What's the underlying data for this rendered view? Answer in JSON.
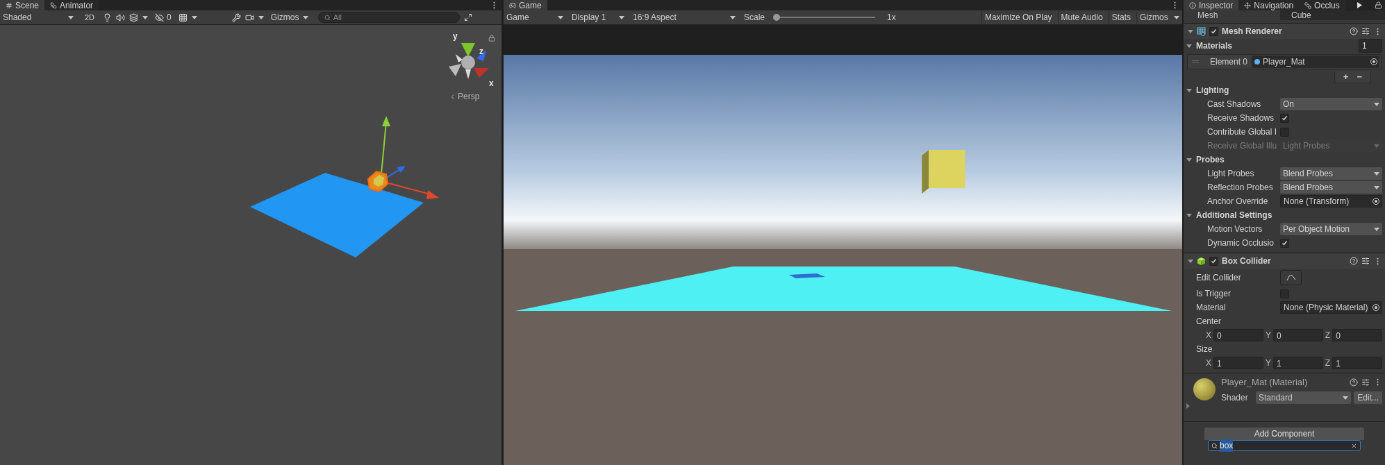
{
  "scene_panel": {
    "tabs": [
      {
        "label": "Scene",
        "selected": true
      },
      {
        "label": "Animator",
        "selected": false
      }
    ],
    "toolbar": {
      "shading": "Shaded",
      "mode_2d": "2D",
      "hidden_count": "0",
      "gizmos": "Gizmos",
      "search": {
        "placeholder": "All"
      }
    },
    "axis_labels": [
      "y",
      "z",
      "x"
    ],
    "view_label": "Persp"
  },
  "game_panel": {
    "tabs": [
      {
        "label": "Game",
        "selected": true
      }
    ],
    "toolbar": {
      "mode": "Game",
      "display": "Display 1",
      "aspect": "16:9 Aspect",
      "scale_label": "Scale",
      "scale": {
        "level": 0,
        "reading": "1x"
      },
      "buttons": [
        "Maximize On Play",
        "Mute Audio",
        "Stats"
      ],
      "gizmos": "Gizmos"
    }
  },
  "inspector": {
    "tabs": [
      {
        "label": "Inspector",
        "selected": true
      },
      {
        "label": "Navigation",
        "selected": false
      },
      {
        "label": "Occlus",
        "selected": false
      }
    ],
    "cut_row": {
      "label": "Mesh",
      "value": "Cube"
    },
    "components": [
      {
        "title": "Mesh Renderer",
        "enabled": true,
        "expanded": true,
        "rows": [
          {
            "kind": "section",
            "label": "Materials",
            "count": "1",
            "expanded": true,
            "children": [
              {
                "kind": "element",
                "label": "Element 0",
                "value": "Player_Mat"
              },
              {
                "kind": "list_buttons",
                "buttons": [
                  "+",
                  "−"
                ]
              }
            ]
          },
          {
            "kind": "section",
            "label": "Lighting",
            "expanded": true,
            "children": [
              {
                "kind": "dropdown",
                "label": "Cast Shadows",
                "value": "On",
                "disabled": false
              },
              {
                "kind": "checkbox",
                "label": "Receive Shadows",
                "checked": true
              },
              {
                "kind": "checkbox",
                "label": "Contribute Global I",
                "checked": false
              },
              {
                "kind": "dropdown",
                "label": "Receive Global Illu",
                "value": "Light Probes",
                "disabled": true
              }
            ]
          },
          {
            "kind": "section",
            "label": "Probes",
            "expanded": true,
            "children": [
              {
                "kind": "dropdown",
                "label": "Light Probes",
                "value": "Blend Probes",
                "disabled": false
              },
              {
                "kind": "dropdown",
                "label": "Reflection Probes",
                "value": "Blend Probes",
                "disabled": false
              },
              {
                "kind": "object",
                "label": "Anchor Override",
                "value": "None (Transform)"
              }
            ]
          },
          {
            "kind": "section",
            "label": "Additional Settings",
            "expanded": true,
            "children": [
              {
                "kind": "dropdown",
                "label": "Motion Vectors",
                "value": "Per Object Motion",
                "disabled": false
              },
              {
                "kind": "checkbox",
                "label": "Dynamic Occlusio",
                "checked": true
              }
            ]
          }
        ]
      },
      {
        "title": "Box Collider",
        "enabled": true,
        "expanded": true,
        "rows": [
          {
            "kind": "edit_button",
            "label": "Edit Collider"
          },
          {
            "kind": "checkbox",
            "label": "Is Trigger",
            "checked": false
          },
          {
            "kind": "object",
            "label": "Material",
            "value": "None (Physic Material)"
          },
          {
            "kind": "label",
            "label": "Center"
          },
          {
            "kind": "vector",
            "values": [
              {
                "axis": "X",
                "value": "0"
              },
              {
                "axis": "Y",
                "value": "0"
              },
              {
                "axis": "Z",
                "value": "0"
              }
            ]
          },
          {
            "kind": "label",
            "label": "Size"
          },
          {
            "kind": "vector",
            "values": [
              {
                "axis": "X",
                "value": "1"
              },
              {
                "axis": "Y",
                "value": "1"
              },
              {
                "axis": "Z",
                "value": "1"
              }
            ]
          }
        ]
      }
    ],
    "material": {
      "name": "Player_Mat (Material)",
      "shader_label": "Shader",
      "shader": "Standard",
      "edit_button": "Edit...",
      "expanded": false
    },
    "add_component": {
      "label": "Add Component",
      "search": {
        "value": "box",
        "text_selected": true
      }
    }
  }
}
